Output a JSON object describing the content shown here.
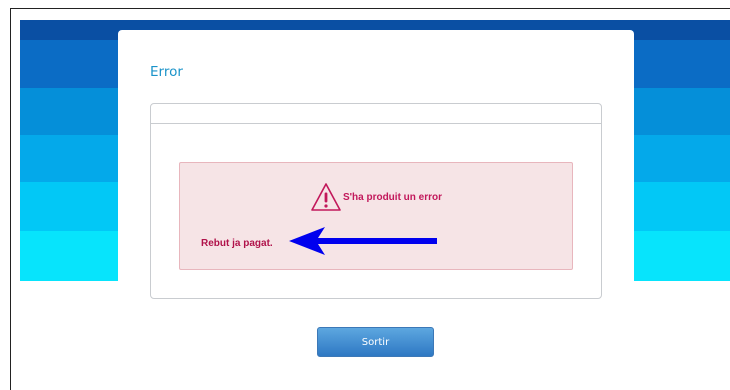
{
  "dialog": {
    "title": "Error"
  },
  "alert": {
    "title": "S'ha produit un error",
    "message": "Rebut ja pagat.",
    "icon": "warning-triangle-icon",
    "color": "#c2185b"
  },
  "buttons": {
    "exit_label": "Sortir"
  },
  "annotation": {
    "icon": "arrow-left-icon",
    "color": "#0000ee"
  },
  "colors": {
    "stripes": [
      "#0a4fa3",
      "#0b6cc5",
      "#058fd9",
      "#04a9ea",
      "#02c8f6",
      "#07e4fc"
    ],
    "button": "#2e78c3",
    "title": "#1a93c9"
  }
}
